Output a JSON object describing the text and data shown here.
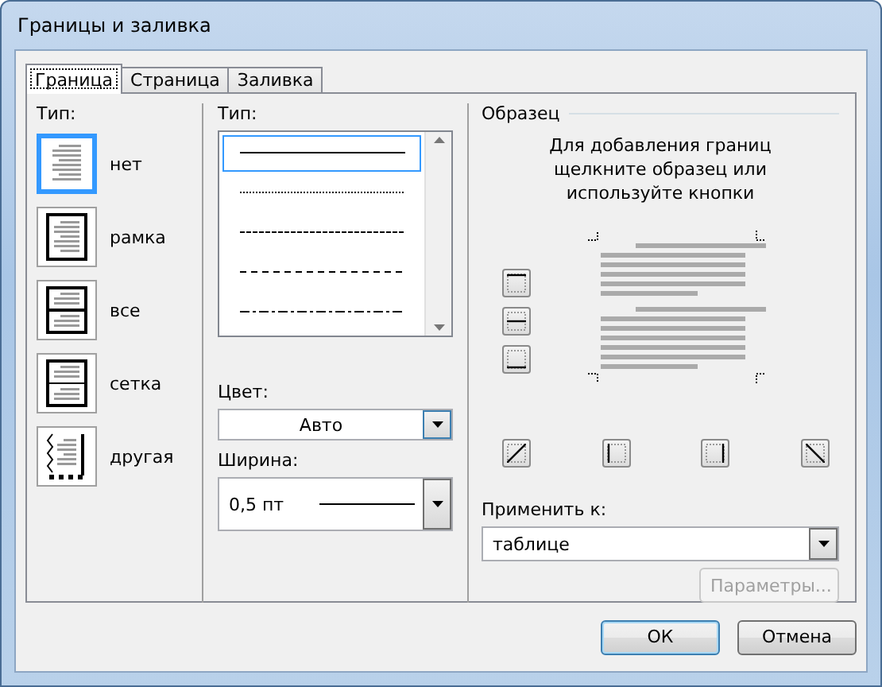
{
  "window": {
    "title": "Границы и заливка"
  },
  "tabs": [
    {
      "label": "Граница",
      "selected": true
    },
    {
      "label": "Страница",
      "selected": false
    },
    {
      "label": "Заливка",
      "selected": false
    }
  ],
  "setting": {
    "label": "Тип:",
    "items": [
      {
        "label": "нет",
        "kind": "none",
        "selected": true
      },
      {
        "label": "рамка",
        "kind": "box",
        "selected": false
      },
      {
        "label": "все",
        "kind": "all",
        "selected": false
      },
      {
        "label": "сетка",
        "kind": "grid",
        "selected": false
      },
      {
        "label": "другая",
        "kind": "custom",
        "selected": false
      }
    ]
  },
  "style": {
    "label": "Тип:",
    "items": [
      {
        "kind": "solid",
        "selected": true
      },
      {
        "kind": "dotted",
        "selected": false
      },
      {
        "kind": "fine-dashed",
        "selected": false
      },
      {
        "kind": "dashed",
        "selected": false
      },
      {
        "kind": "dash-dot",
        "selected": false
      }
    ]
  },
  "color": {
    "label": "Цвет:",
    "value": "Авто"
  },
  "width": {
    "label": "Ширина:",
    "value": "0,5 пт"
  },
  "preview": {
    "heading": "Образец",
    "hint": "Для добавления границ щелкните образец или используйте кнопки",
    "apply_label": "Применить к:",
    "apply_value": "таблице",
    "options_button": {
      "label": "Параметры...",
      "disabled": true
    }
  },
  "buttons": [
    {
      "label": "ОК",
      "default": true
    },
    {
      "label": "Отмена",
      "default": false
    }
  ]
}
